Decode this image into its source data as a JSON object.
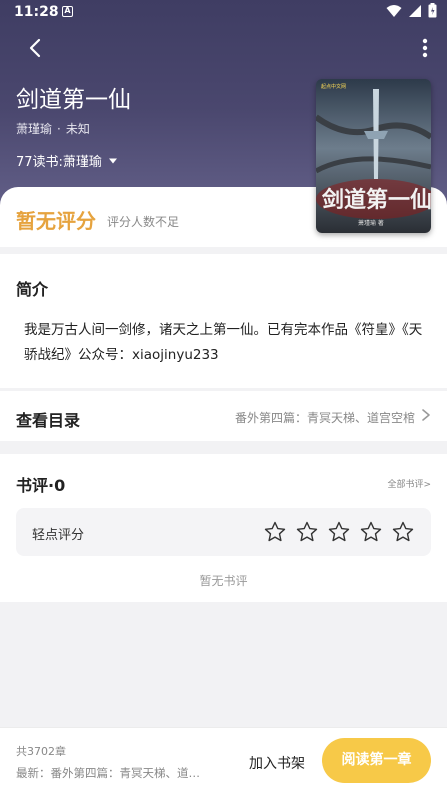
{
  "status_bar": {
    "time": "11:28",
    "notification_icon": "A"
  },
  "book": {
    "title": "剑道第一仙",
    "author": "萧瑾瑜",
    "status": "未知",
    "source": "77读书:萧瑾瑜",
    "cover_title": "剑道第一仙",
    "cover_author": "萧瑾瑜 著",
    "cover_publisher": "起点中文网"
  },
  "rating": {
    "headline": "暂无评分",
    "note": "评分人数不足"
  },
  "intro": {
    "heading": "简介",
    "text": "我是万古人间一剑修，诸天之上第一仙。已有完本作品《符皇》《天骄战纪》公众号：xiaojinyu233"
  },
  "toc": {
    "heading": "查看目录",
    "latest": "番外第四篇：青冥天梯、道宫空棺"
  },
  "reviews": {
    "heading": "书评·0",
    "all_link": "全部书评>",
    "rate_label": "轻点评分",
    "star_count": 5,
    "empty_text": "暂无书评"
  },
  "bottom": {
    "chapter_count": "共3702章",
    "latest": "最新：番外第四篇：青冥天梯、道…",
    "add_shelf": "加入书架",
    "read_first": "阅读第一章"
  },
  "colors": {
    "accent": "#f7c948",
    "rating_orange": "#e6a33e",
    "header": "#4a476e"
  }
}
